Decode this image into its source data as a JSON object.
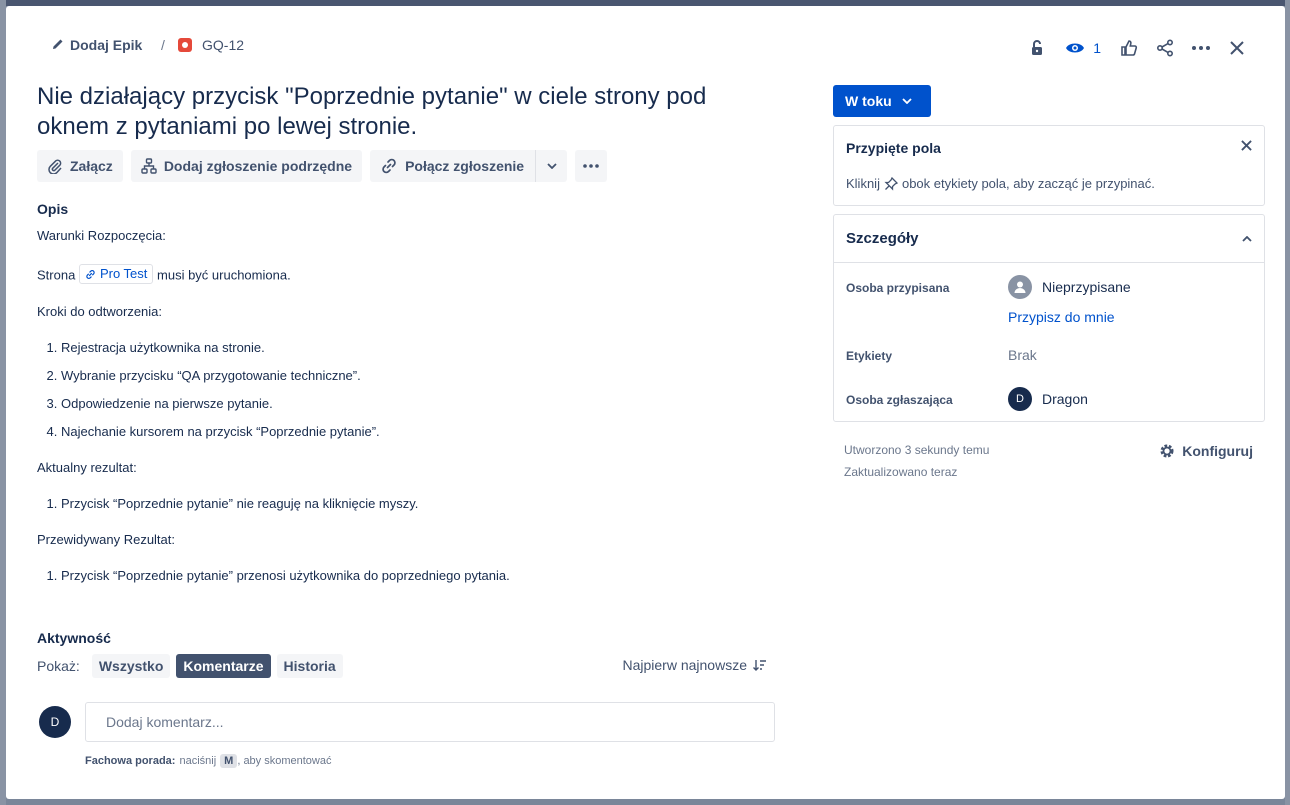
{
  "breadcrumb": {
    "epic_label": "Dodaj Epik",
    "separator": "/",
    "issue_key": "GQ-12"
  },
  "header": {
    "watch_count": "1"
  },
  "issue": {
    "title": "Nie działający przycisk \"Poprzednie pytanie\" w ciele strony pod oknem z pytaniami po lewej stronie."
  },
  "toolbar": {
    "attach": "Załącz",
    "add_child": "Dodaj zgłoszenie podrzędne",
    "link_issue": "Połącz zgłoszenie"
  },
  "description": {
    "heading": "Opis",
    "preconditions": "Warunki Rozpoczęcia:",
    "page_prefix": "Strona",
    "page_link": "Pro Test",
    "page_suffix": "musi być uruchomiona.",
    "steps_heading": "Kroki do odtworzenia:",
    "steps": [
      "Rejestracja użytkownika na stronie.",
      "Wybranie przycisku “QA przygotowanie techniczne”.",
      "Odpowiedzenie na pierwsze pytanie.",
      "Najechanie kursorem na przycisk “Poprzednie pytanie”."
    ],
    "actual_heading": "Aktualny rezultat:",
    "actual": [
      "Przycisk “Poprzednie pytanie” nie reaguję na kliknięcie myszy."
    ],
    "expected_heading": "Przewidywany Rezultat:",
    "expected": [
      "Przycisk “Poprzednie pytanie” przenosi użytkownika do poprzedniego pytania."
    ]
  },
  "activity": {
    "heading": "Aktywność",
    "show_label": "Pokaż:",
    "filters": [
      "Wszystko",
      "Komentarze",
      "Historia"
    ],
    "active_filter": "Komentarze",
    "sort_label": "Najpierw najnowsze",
    "comment_placeholder": "Dodaj komentarz...",
    "user_initial": "D",
    "tip_bold": "Fachowa porada:",
    "tip_text": "naciśnij",
    "tip_key": "M",
    "tip_suffix": ", aby skomentować"
  },
  "sidebar": {
    "status": "W toku",
    "pinned": {
      "title": "Przypięte pola",
      "hint_prefix": "Kliknij",
      "hint_suffix": "obok etykiety pola, aby zacząć je przypinać."
    },
    "details": {
      "title": "Szczegóły",
      "assignee_label": "Osoba przypisana",
      "assignee_value": "Nieprzypisane",
      "assign_to_me": "Przypisz do mnie",
      "labels_label": "Etykiety",
      "labels_value": "Brak",
      "reporter_label": "Osoba zgłaszająca",
      "reporter_value": "Dragon",
      "reporter_initial": "D"
    },
    "created": "Utworzono 3 sekundy temu",
    "updated": "Zaktualizowano teraz",
    "configure": "Konfiguruj"
  }
}
